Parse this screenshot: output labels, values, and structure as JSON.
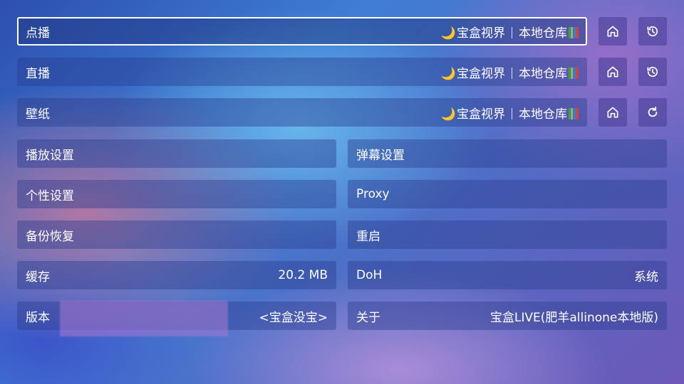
{
  "sources": {
    "vod": {
      "label": "点播",
      "site": "宝盒视界",
      "repo": "本地仓库"
    },
    "live": {
      "label": "直播",
      "site": "宝盒视界",
      "repo": "本地仓库"
    },
    "wallpaper": {
      "label": "壁纸",
      "site": "宝盒视界",
      "repo": "本地仓库"
    }
  },
  "icons": {
    "home": "home-icon",
    "history": "history-icon",
    "refresh": "refresh-icon",
    "moon": "🌙",
    "books": "books-icon"
  },
  "settings": {
    "play": "播放设置",
    "danmaku": "弹幕设置",
    "personal": "个性设置",
    "proxy": "Proxy",
    "backup": "备份恢复",
    "restart": "重启",
    "cache": {
      "label": "缓存",
      "value": "20.2 MB"
    },
    "doh": {
      "label": "DoH",
      "value": "系统"
    },
    "version": {
      "label": "版本",
      "value": "<宝盒没宝>"
    },
    "about": {
      "label": "关于",
      "value": "宝盒LIVE(肥羊allinone本地版)"
    }
  }
}
